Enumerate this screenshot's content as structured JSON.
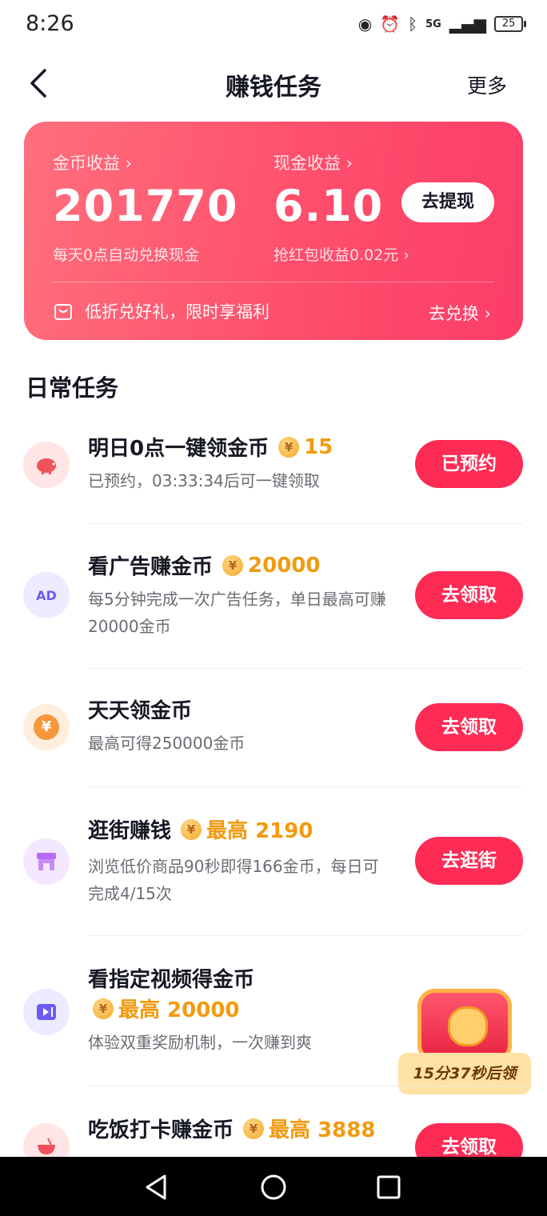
{
  "status_bar": {
    "time": "8:26",
    "network": "5G",
    "battery": "25"
  },
  "nav": {
    "title": "赚钱任务",
    "more": "更多"
  },
  "earnings": {
    "coin_label": "金币收益 ›",
    "coin_value": "201770",
    "coin_sub": "每天0点自动兑换现金",
    "cash_label": "现金收益 ›",
    "cash_value": "6.10",
    "cash_sub": "抢红包收益0.02元 ›",
    "withdraw_btn": "去提现",
    "promo_text": "低折兑好礼，限时享福利",
    "exchange_link": "去兑换 ›"
  },
  "section_title": "日常任务",
  "tasks": [
    {
      "name": "明日0点一键领金币",
      "reward": "15",
      "desc": "已预约，03:33:34后可一键领取",
      "button": "已预约",
      "icon": "piggy-bank-icon"
    },
    {
      "name": "看广告赚金币",
      "reward": "20000",
      "desc": "每5分钟完成一次广告任务，单日最高可赚20000金币",
      "button": "去领取",
      "icon_text": "AD"
    },
    {
      "name": "天天领金币",
      "reward": "",
      "desc": "最高可得250000金币",
      "button": "去领取",
      "icon_text": "¥"
    },
    {
      "name": "逛街赚钱",
      "reward": "最高 2190",
      "desc": "浏览低价商品90秒即得166金币，每日可完成4/15次",
      "button": "去逛街",
      "icon": "shop-icon"
    },
    {
      "name": "看指定视频得金币",
      "reward": "最高 20000",
      "desc": "体验双重奖励机制，一次赚到爽",
      "button": "",
      "icon": "video-icon"
    },
    {
      "name": "吃饭打卡赚金币",
      "reward": "最高 3888",
      "desc": "",
      "button": "去领取",
      "icon": "bowl-icon"
    }
  ],
  "coin_glyph": "¥",
  "chest": {
    "label": "15分37秒后领"
  },
  "colors": {
    "accent": "#fe2c55",
    "reward": "#f29a0f"
  }
}
